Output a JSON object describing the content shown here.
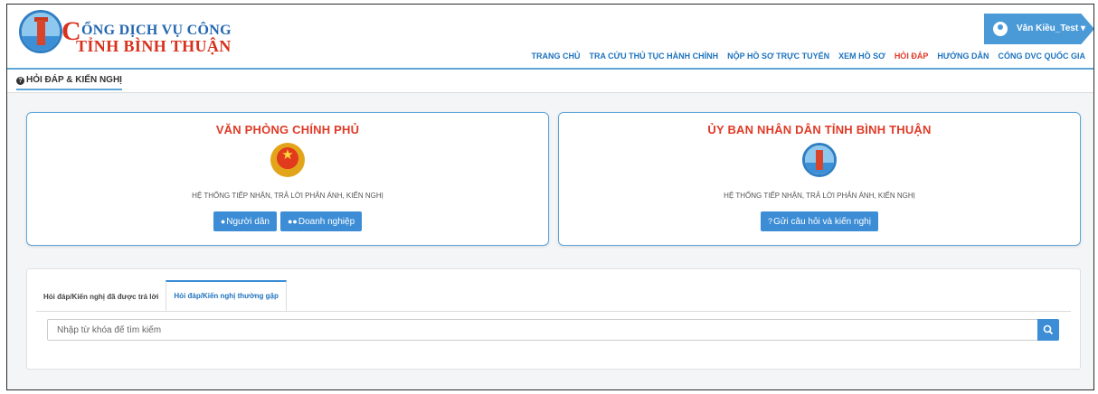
{
  "header": {
    "logo_line1_initial": "C",
    "logo_line1_rest": "ỔNG DỊCH VỤ CÔNG",
    "logo_line2": "TỈNH BÌNH THUẬN",
    "user_name": "Văn Kiều_Test",
    "user_caret": "▾"
  },
  "nav": [
    {
      "label": "TRANG CHỦ",
      "active": false
    },
    {
      "label": "TRA CỨU THỦ TỤC HÀNH CHÍNH",
      "active": false
    },
    {
      "label": "NỘP HỒ SƠ TRỰC TUYẾN",
      "active": false
    },
    {
      "label": "XEM HỒ SƠ",
      "active": false
    },
    {
      "label": "HỎI ĐÁP",
      "active": true
    },
    {
      "label": "HƯỚNG DẪN",
      "active": false
    },
    {
      "label": "CỔNG DVC QUỐC GIA",
      "active": false
    }
  ],
  "page_tab": {
    "label": "HỎI ĐÁP & KIẾN NGHỊ",
    "icon": "question-circle-icon"
  },
  "cards": {
    "left": {
      "title": "VĂN PHÒNG CHÍNH PHỦ",
      "subtitle": "HỆ THỐNG TIẾP NHẬN, TRẢ LỜI PHẢN ÁNH, KIẾN NGHỊ",
      "btn_citizen": "Người dân",
      "btn_business": "Doanh nghiệp"
    },
    "right": {
      "title": "ỦY BAN NHÂN DÂN TỈNH BÌNH THUẬN",
      "subtitle": "HỆ THỐNG TIẾP NHẬN, TRẢ LỜI PHẢN ÁNH, KIẾN NGHỊ",
      "btn_submit": "Gửi câu hỏi và kiến nghị"
    }
  },
  "faq": {
    "tab_answered": "Hỏi đáp/Kiến nghị đã được trả lời",
    "tab_common": "Hỏi đáp/Kiến nghị thường gặp",
    "search_placeholder": "Nhập từ khóa để tìm kiếm"
  },
  "colors": {
    "accent": "#3c8dd6",
    "active_nav": "#e03a27",
    "nav": "#1e73be"
  }
}
